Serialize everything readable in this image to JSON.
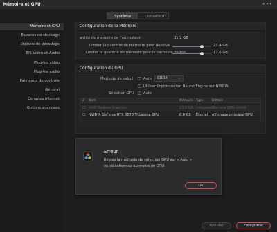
{
  "window": {
    "title": "Mémoire et GPU",
    "more": "•••"
  },
  "tabs": [
    {
      "label": "Système"
    },
    {
      "label": "Utilisateur"
    }
  ],
  "sidebar": {
    "items": [
      {
        "label": "Mémoire et GPU"
      },
      {
        "label": "Espaces de stockage"
      },
      {
        "label": "Options de décodage"
      },
      {
        "label": "E/S Vidéo et Audio"
      },
      {
        "label": "Plug-ins vidéo"
      },
      {
        "label": "Plug-ins audio"
      },
      {
        "label": "Panneaux de contrôle"
      },
      {
        "label": "Général"
      },
      {
        "label": "Comptes internet"
      },
      {
        "label": "Options avancées"
      }
    ]
  },
  "memory": {
    "header": "Configuration de la Mémoire",
    "total_label": "antité de mémoire de l'ordinateur",
    "total_value": "31.2 GB",
    "resolve_label": "Limiter la quantité de mémoire pour Resolve",
    "resolve_value": "23.4 GB",
    "resolve_fraction": 0.75,
    "fusion_label": "Limiter la quantité de mémoire pour le cache de Fusion",
    "fusion_value": "17.6 GB",
    "fusion_fraction": 0.75
  },
  "gpu": {
    "header": "Configuration du GPU",
    "processing_label": "Méthode de calcul",
    "auto_label": "Auto",
    "processing_value": "CUDA",
    "neural_label": "Utiliser l'optimisation Neural Engine sur NVIDIA",
    "selection_label": "Sélection GPU",
    "selection_auto": "Auto",
    "columns": {
      "num": "2",
      "name": "Nom",
      "memory": "Mémoire",
      "type": "Type",
      "details": "Détails"
    },
    "rows": [
      {
        "name": "AMD Radeon Graphics",
        "memory": "13.6 GB",
        "type": "Integrated",
        "details": "Discrete GPU utilisé"
      },
      {
        "name": "NVIDIA GeForce RTX 3070 Ti Laptop GPU",
        "memory": "8.0 GB",
        "type": "Discret",
        "details": "Affichage principal GPU"
      }
    ]
  },
  "dialog": {
    "title": "Erreur",
    "message_line1": "Réglez la méthode de sélection GPU sur « Auto »",
    "message_line2": "ou sélectionnez au moins un GPU.",
    "ok_label": "Ok"
  },
  "footer": {
    "cancel_label": "Annuler",
    "save_label": "Enregistrer"
  },
  "colors": {
    "accent_red": "#d9484a",
    "text": "#c8c8c8",
    "panel": "#232325"
  }
}
